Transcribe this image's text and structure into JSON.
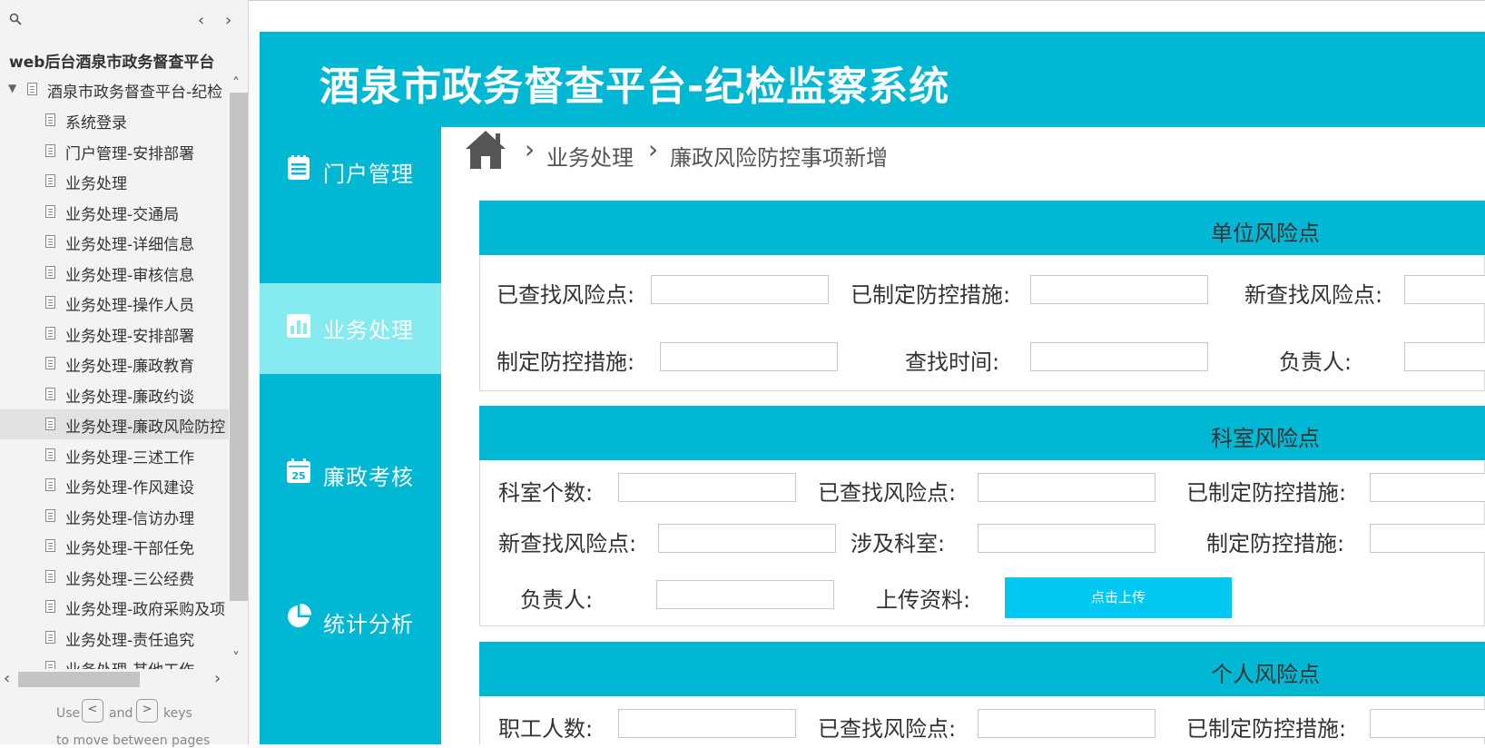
{
  "sitemap": {
    "project_title": "web后台酒泉市政务督查平台",
    "root_label": "酒泉市政务督查平台-纪检",
    "items": [
      "系统登录",
      "门户管理-安排部署",
      "业务处理",
      "业务处理-交通局",
      "业务处理-详细信息",
      "业务处理-审核信息",
      "业务处理-操作人员",
      "业务处理-安排部署",
      "业务处理-廉政教育",
      "业务处理-廉政约谈",
      "业务处理-廉政风险防控",
      "业务处理-三述工作",
      "业务处理-作风建设",
      "业务处理-信访办理",
      "业务处理-干部任免",
      "业务处理-三公经费",
      "业务处理-政府采购及项",
      "业务处理-责任追究",
      "业务处理-其他工作"
    ],
    "selected_index": 10,
    "key_hint": {
      "use": "Use",
      "left_key": "<",
      "and": "and",
      "right_key": ">",
      "keys": "keys",
      "move": "to move between pages"
    }
  },
  "app": {
    "title": "酒泉市政务督查平台-纪检监察系统"
  },
  "nav": {
    "items": [
      {
        "label": "门户管理",
        "icon": "list-icon"
      },
      {
        "label": "业务处理",
        "icon": "bar-chart-icon"
      },
      {
        "label": "廉政考核",
        "icon": "calendar-icon"
      },
      {
        "label": "统计分析",
        "icon": "pie-chart-icon"
      }
    ],
    "active_index": 1,
    "calendar_day": "25"
  },
  "breadcrumb": {
    "level1": "业务处理",
    "level2": "廉政风险防控事项新增"
  },
  "sections": {
    "unit": {
      "title": "单位风险点",
      "fields": {
        "found_points": "已查找风险点:",
        "made_measures": "已制定防控措施:",
        "new_found_points": "新查找风险点:",
        "measures": "制定防控措施:",
        "find_time": "查找时间:",
        "person_in_charge": "负责人:"
      }
    },
    "dept": {
      "title": "科室风险点",
      "fields": {
        "dept_count": "科室个数:",
        "found_points": "已查找风险点:",
        "made_measures": "已制定防控措施:",
        "new_found_points": "新查找风险点:",
        "involved_depts": "涉及科室:",
        "measures": "制定防控措施:",
        "person_in_charge": "负责人:",
        "upload": "上传资料:"
      },
      "upload_button": "点击上传"
    },
    "personal": {
      "title": "个人风险点",
      "fields": {
        "staff_count": "职工人数:",
        "found_points": "已查找风险点:",
        "made_measures": "已制定防控措施:"
      }
    }
  },
  "colors": {
    "primary": "#00b8d4",
    "nav_active": "#86ebf0",
    "upload_button": "#00c8f0"
  }
}
